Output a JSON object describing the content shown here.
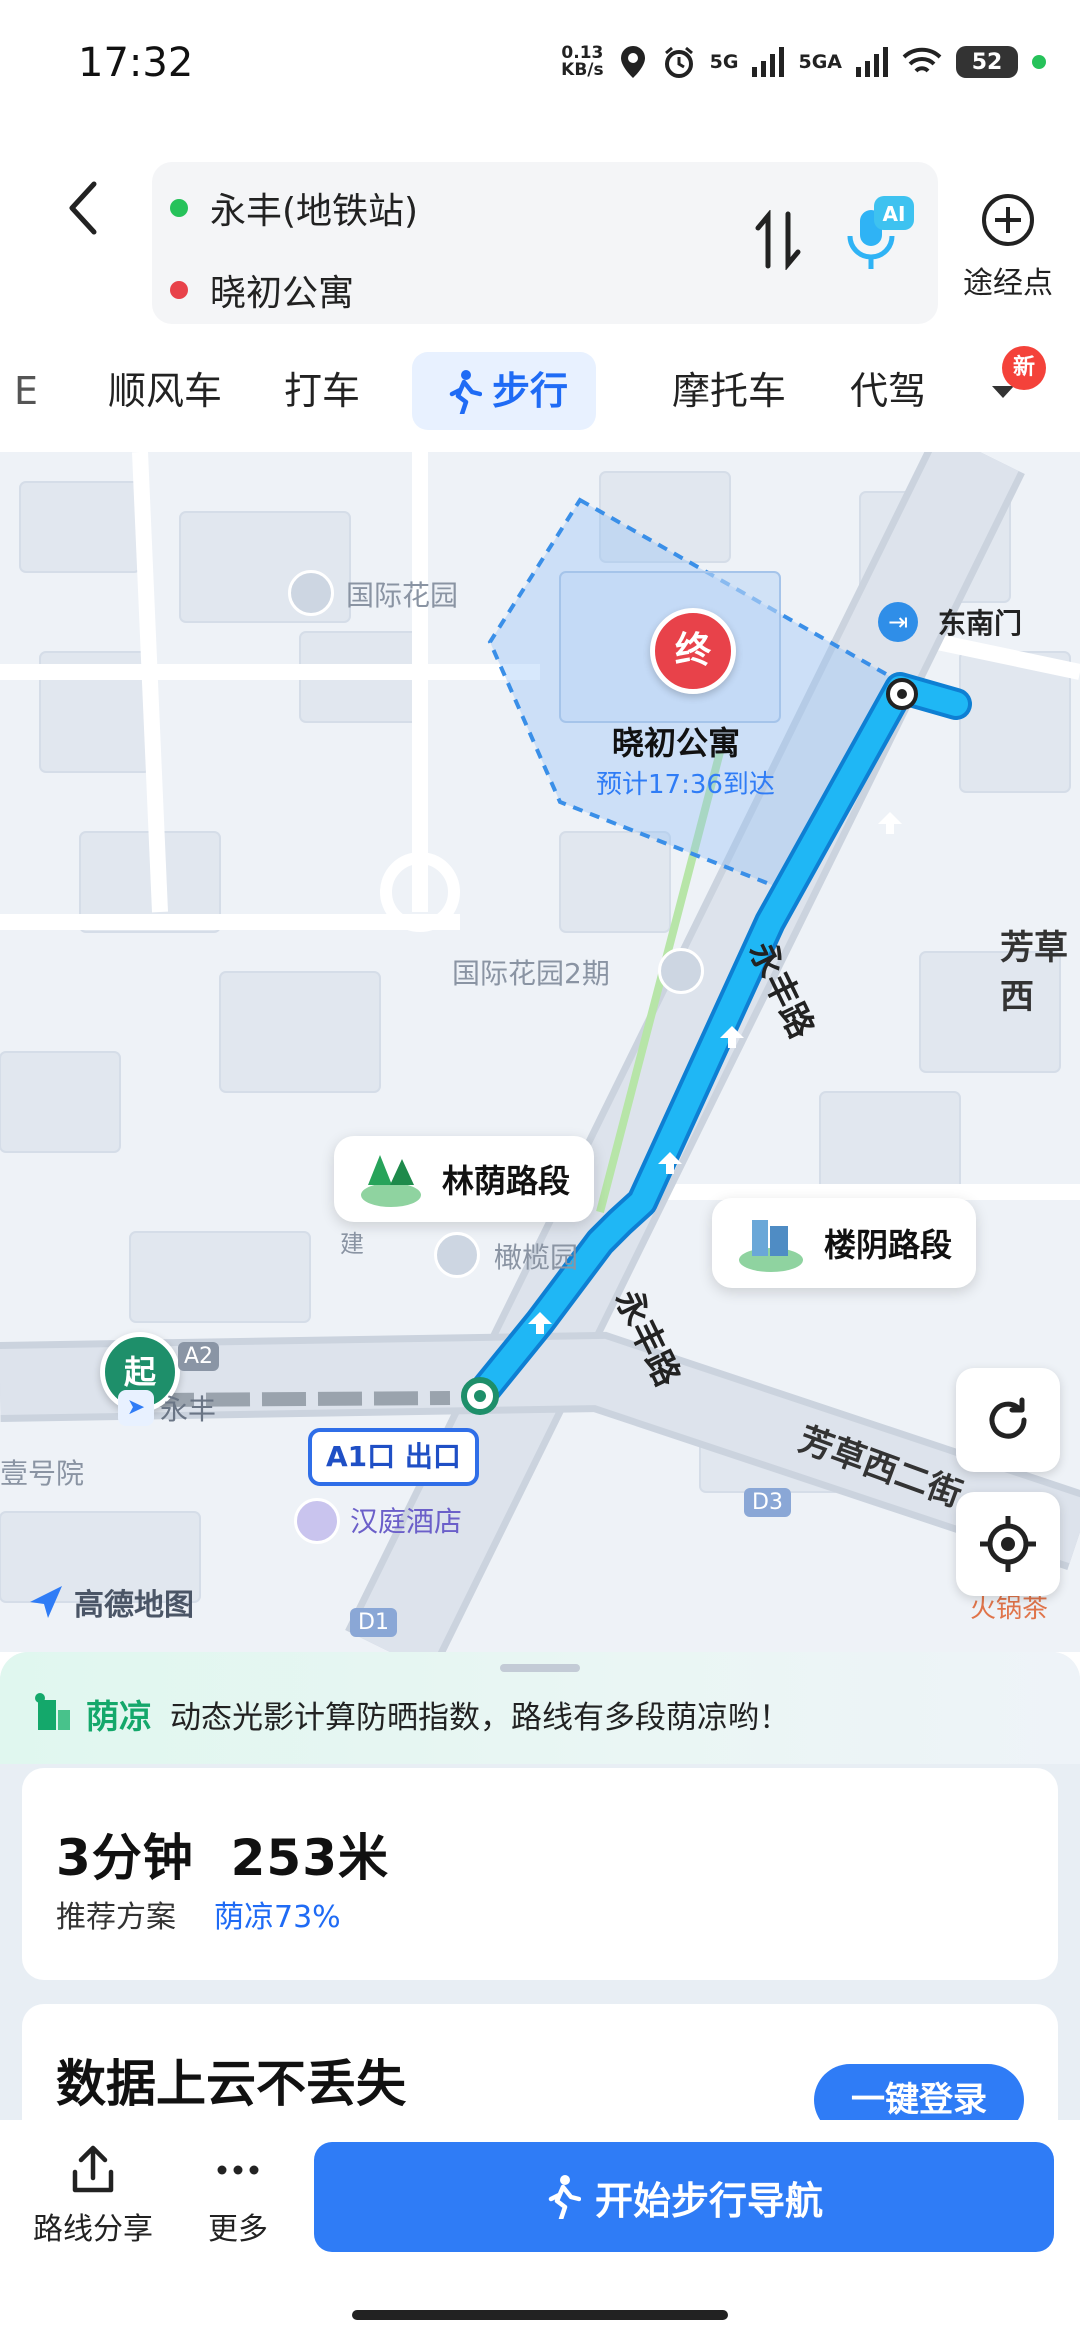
{
  "status": {
    "time": "17:32",
    "net_speed_value": "0.13",
    "net_speed_unit": "KB/s",
    "sig1": "5G",
    "sig2": "5GA",
    "battery": "52"
  },
  "route": {
    "origin": "永丰(地铁站)",
    "destination": "晓初公寓",
    "ai_badge": "AI",
    "via_label": "途经点"
  },
  "tabs": [
    {
      "label": "顺风车"
    },
    {
      "label": "打车"
    },
    {
      "label": "步行",
      "active": true
    },
    {
      "label": "摩托车"
    },
    {
      "label": "代驾"
    }
  ],
  "tab_partial": "E",
  "new_badge": "新",
  "map": {
    "poi_guoji": "国际花园",
    "gate": "东南门",
    "end_marker": "终",
    "dest_name": "晓初公寓",
    "eta": "预计17:36到达",
    "poi_guoji2": "国际花园2期",
    "road_fangcao": "芳草西",
    "road_yongfeng": "永丰路",
    "callout_lin": "林荫路段",
    "callout_lou": "楼阴路段",
    "poi_ganlan": "橄榄园",
    "road_jian": "建",
    "start_marker": "起",
    "exit_a2": "A2",
    "station": "永丰",
    "exit_a1": "A1口 出口",
    "poi_yihao": "壹号院",
    "poi_hanting": "汉庭酒店",
    "exit_d3": "D3",
    "exit_d1": "D1",
    "road_fangcao2": "芳草西二街",
    "brand": "高德地图",
    "poi_hotpot": "火锅茶"
  },
  "shade": {
    "title": "荫凉",
    "desc": "动态光影计算防晒指数，路线有多段荫凉哟！"
  },
  "summary": {
    "duration": "3分钟",
    "distance": "253米",
    "plan": "推荐方案",
    "shade_pct": "荫凉73%"
  },
  "login": {
    "title": "数据上云不丢失",
    "button": "一键登录"
  },
  "bottom": {
    "share": "路线分享",
    "more": "更多",
    "start_nav": "开始步行导航"
  },
  "colors": {
    "accent": "#2f7cf6",
    "route": "#1fa9f2",
    "shade": "#14a86b",
    "end_marker": "#e8424a",
    "start_marker": "#1e8f6a"
  }
}
